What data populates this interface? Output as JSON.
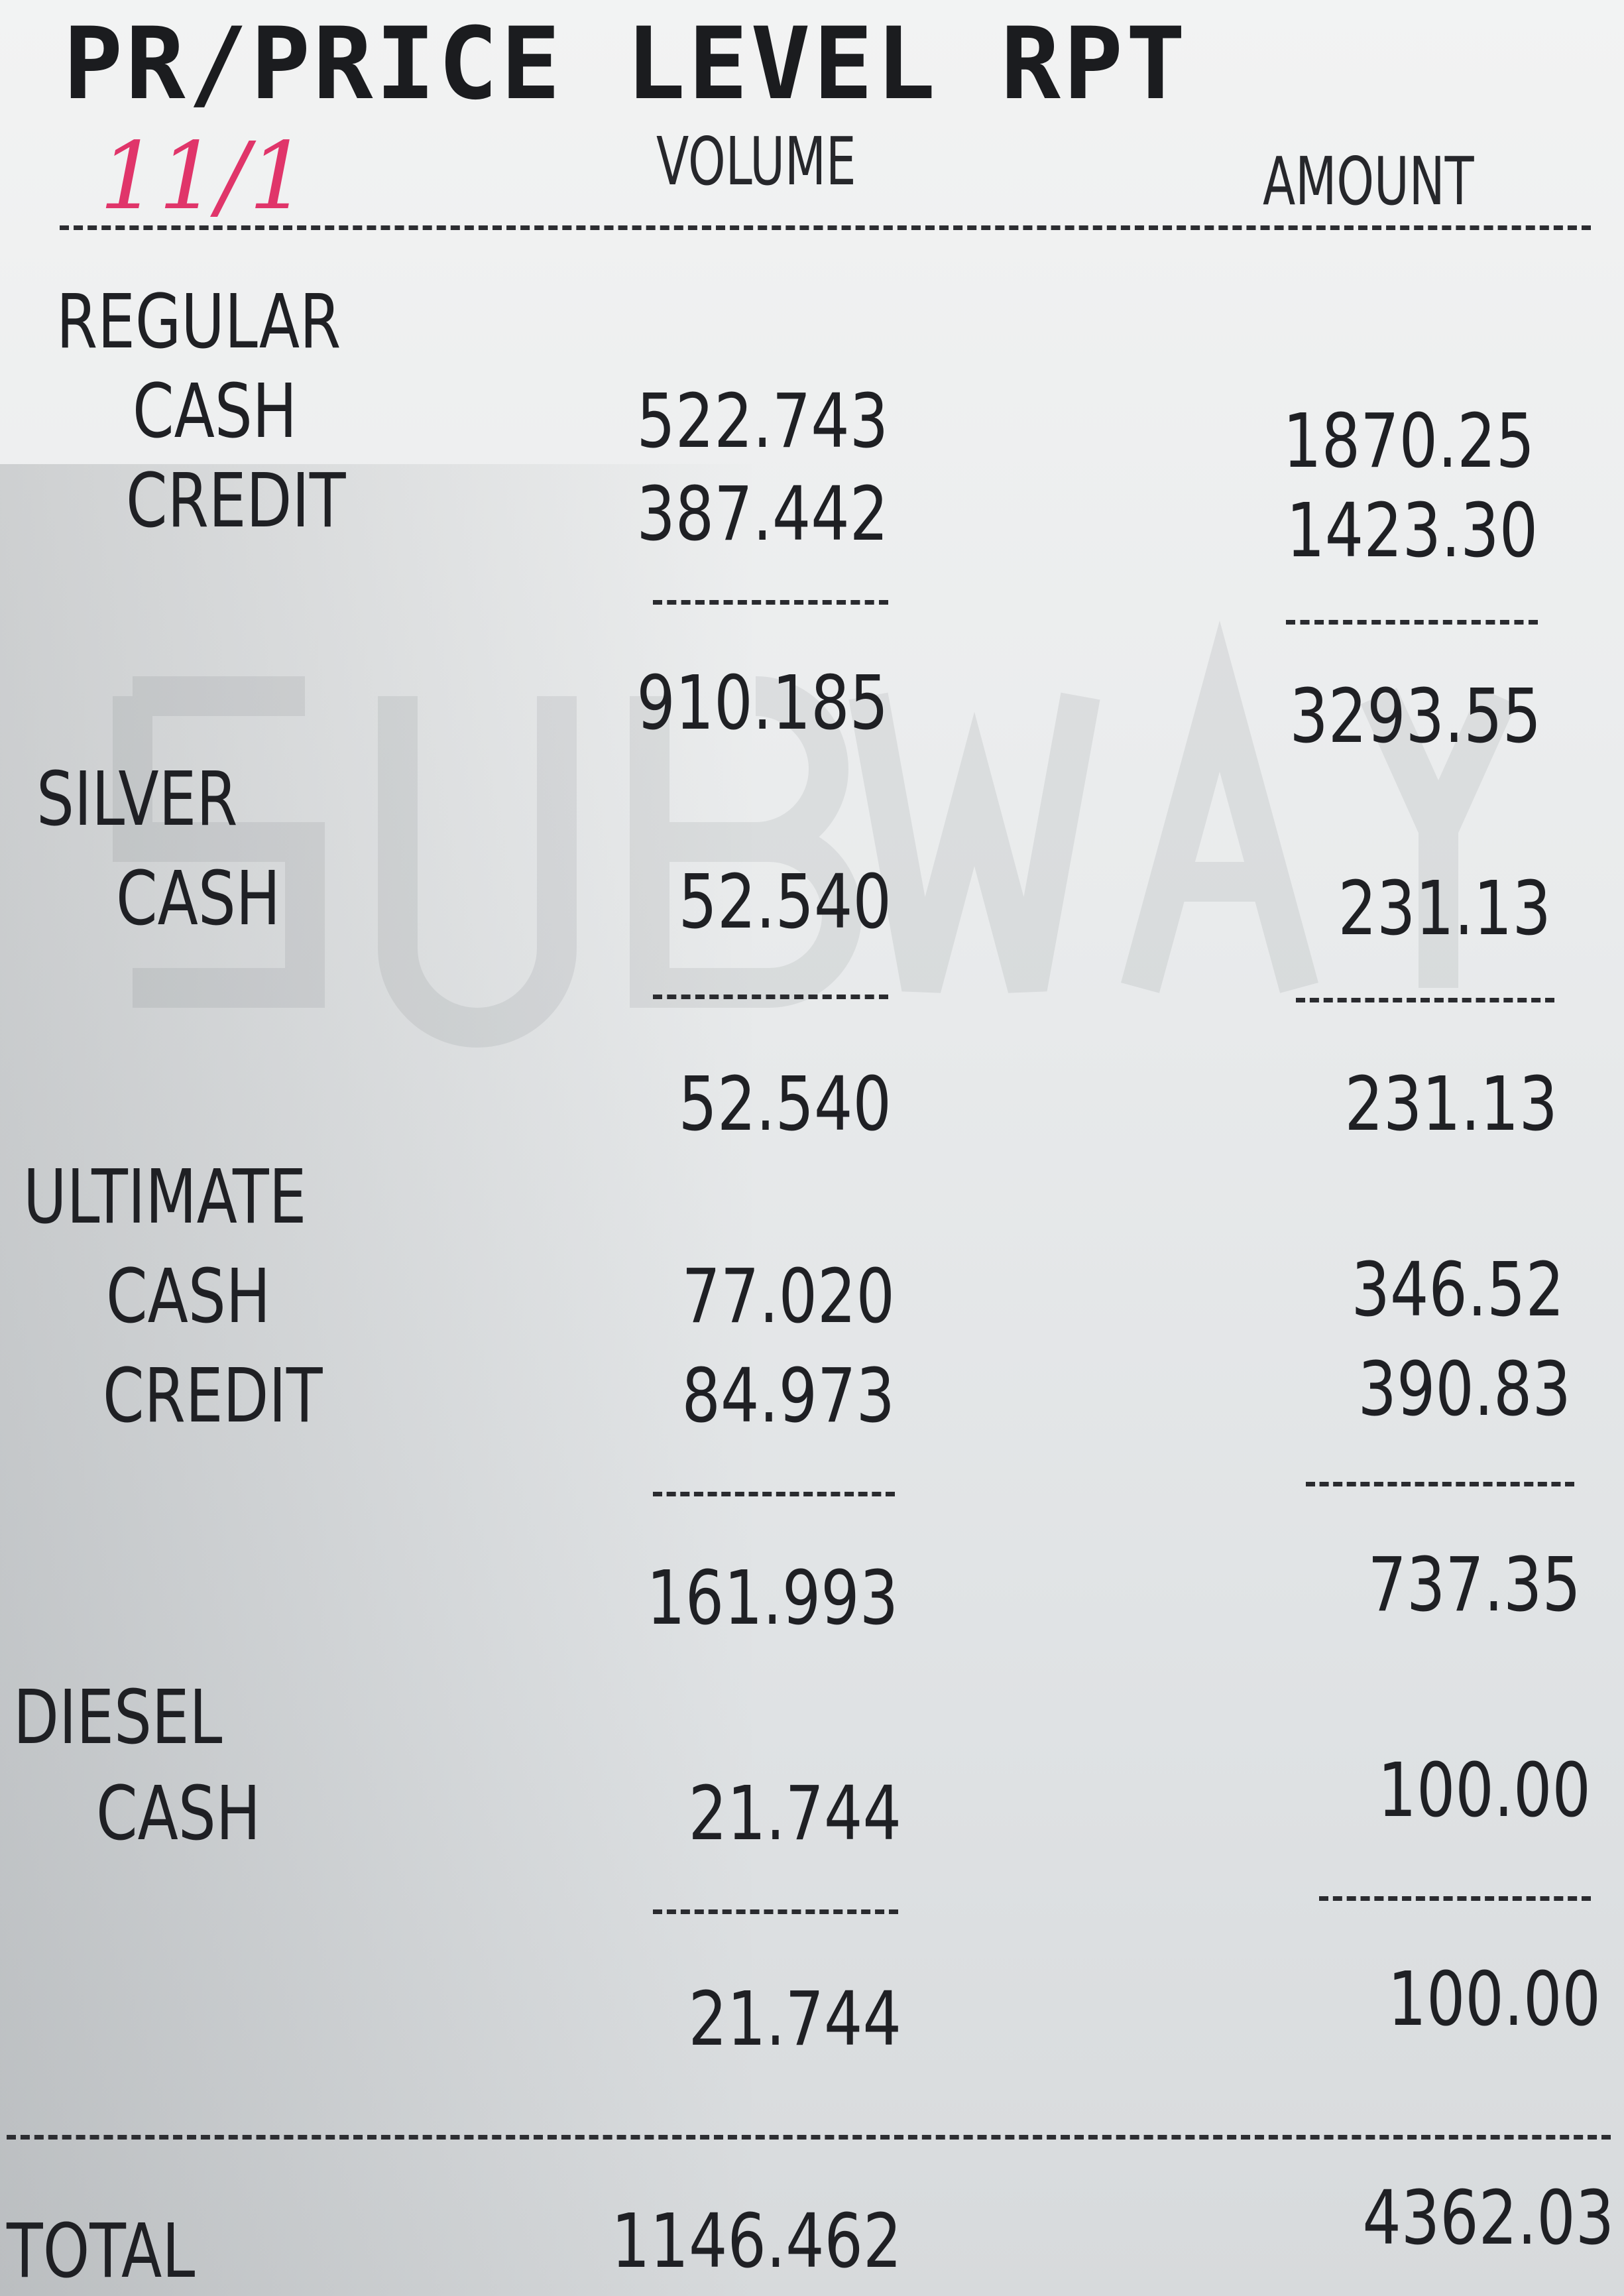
{
  "report": {
    "title": "PR/PRICE LEVEL RPT",
    "handwritten_date": "11/1",
    "columns": {
      "volume": "VOLUME",
      "amount": "AMOUNT"
    },
    "groups": [
      {
        "name": "REGULAR",
        "rows": [
          {
            "label": "CASH",
            "volume": "522.743",
            "amount": "1870.25"
          },
          {
            "label": "CREDIT",
            "volume": "387.442",
            "amount": "1423.30"
          }
        ],
        "subtotal": {
          "volume": "910.185",
          "amount": "3293.55"
        }
      },
      {
        "name": "SILVER",
        "rows": [
          {
            "label": "CASH",
            "volume": "52.540",
            "amount": "231.13"
          }
        ],
        "subtotal": {
          "volume": "52.540",
          "amount": "231.13"
        }
      },
      {
        "name": "ULTIMATE",
        "rows": [
          {
            "label": "CASH",
            "volume": "77.020",
            "amount": "346.52"
          },
          {
            "label": "CREDIT",
            "volume": "84.973",
            "amount": "390.83"
          }
        ],
        "subtotal": {
          "volume": "161.993",
          "amount": "737.35"
        }
      },
      {
        "name": "DIESEL",
        "rows": [
          {
            "label": "CASH",
            "volume": "21.744",
            "amount": "100.00"
          }
        ],
        "subtotal": {
          "volume": "21.744",
          "amount": "100.00"
        }
      }
    ],
    "total": {
      "label": "TOTAL",
      "volume": "1146.462",
      "amount": "4362.03"
    }
  },
  "colors": {
    "paper": "#e9ebec",
    "ink": "#1f2024",
    "handwriting": "#e0356a"
  }
}
